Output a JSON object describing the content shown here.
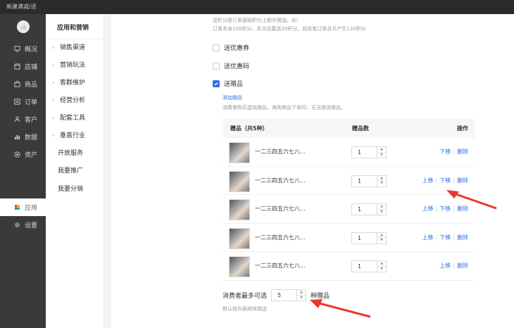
{
  "window": {
    "title": "新建满减/送"
  },
  "nav": {
    "items": [
      {
        "label": "概况",
        "icon": "monitor-icon"
      },
      {
        "label": "店铺",
        "icon": "store-icon"
      },
      {
        "label": "商品",
        "icon": "bag-icon"
      },
      {
        "label": "订单",
        "icon": "list-icon"
      },
      {
        "label": "客户",
        "icon": "user-icon"
      },
      {
        "label": "数据",
        "icon": "bar-chart-icon"
      },
      {
        "label": "资产",
        "icon": "coin-icon"
      },
      {
        "label": "应用",
        "icon": "apps-icon",
        "active": true
      },
      {
        "label": "设置",
        "icon": "gear-icon"
      }
    ]
  },
  "subnav": {
    "title": "应用和营销",
    "items": [
      {
        "label": "销售渠道",
        "arrow": true
      },
      {
        "label": "营销玩法",
        "arrow": true
      },
      {
        "label": "客群维护",
        "arrow": true
      },
      {
        "label": "经营分析",
        "arrow": true
      },
      {
        "label": "配套工具",
        "arrow": true
      },
      {
        "label": "垂直行业",
        "arrow": true
      },
      {
        "label": "开放服务",
        "arrow": false
      },
      {
        "label": "我要推广",
        "arrow": false
      },
      {
        "label": "我要分销",
        "arrow": false
      }
    ]
  },
  "content": {
    "points_note_1": "送积分是订单基础积分上额外赠送。如：",
    "points_note_2": "订单本身100积分，本次设置送20积分，则该笔订单总共产生120积分",
    "options": [
      {
        "label": "送优惠券",
        "checked": false
      },
      {
        "label": "送优惠码",
        "checked": false
      },
      {
        "label": "送赠品",
        "checked": true
      }
    ],
    "add_gift_link": "添加赠品",
    "gift_note": "消费者购买虚拟赠品、海淘商品下单时，无法赠送赠品。",
    "table": {
      "headers": {
        "gift": "赠品（共5种）",
        "count": "赠品数",
        "ops": "操作"
      },
      "rows": [
        {
          "name": "一二三四五六七八...",
          "count": "1",
          "up": "",
          "down": "下移",
          "delete": "删除"
        },
        {
          "name": "一二三四五六七八...",
          "count": "1",
          "up": "上移",
          "down": "下移",
          "delete": "删除"
        },
        {
          "name": "一二三四五六七八...",
          "count": "1",
          "up": "上移",
          "down": "下移",
          "delete": "删除"
        },
        {
          "name": "一二三四五六七八...",
          "count": "1",
          "up": "上移",
          "down": "下移",
          "delete": "删除"
        },
        {
          "name": "一二三四五六七八...",
          "count": "1",
          "up": "上移",
          "down": "",
          "delete": "删除"
        }
      ]
    },
    "max_label_before": "消费者最多可选",
    "max_value": "5",
    "max_label_after": "种赠品",
    "default_note": "默认按列表顺序赠送"
  },
  "colors": {
    "accent": "#2f6fe0",
    "arrow": "#e8372c"
  }
}
